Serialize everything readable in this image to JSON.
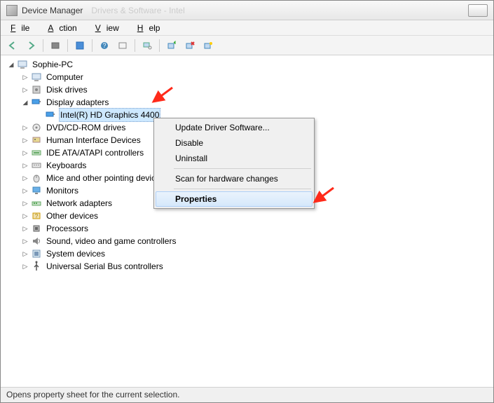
{
  "window": {
    "title": "Device Manager",
    "ghost_title": "Drivers & Software - Intel"
  },
  "menu": {
    "file": "File",
    "action": "Action",
    "view": "View",
    "help": "Help"
  },
  "toolbar": {
    "back": "back",
    "forward": "forward",
    "show_hidden": "show-hidden",
    "properties": "properties",
    "help": "help",
    "refresh": "refresh",
    "scan": "scan",
    "update": "update-driver",
    "uninstall": "uninstall",
    "browse": "browse"
  },
  "tree": {
    "root": "Sophie-PC",
    "children": [
      {
        "label": "Computer",
        "icon": "computer-icon"
      },
      {
        "label": "Disk drives",
        "icon": "disk-icon"
      },
      {
        "label": "Display adapters",
        "icon": "display-adapter-icon",
        "expanded": true,
        "children": [
          {
            "label": "Intel(R) HD Graphics 4400",
            "icon": "display-adapter-icon",
            "selected": true
          }
        ]
      },
      {
        "label": "DVD/CD-ROM drives",
        "icon": "optical-drive-icon"
      },
      {
        "label": "Human Interface Devices",
        "icon": "hid-icon"
      },
      {
        "label": "IDE ATA/ATAPI controllers",
        "icon": "ide-icon"
      },
      {
        "label": "Keyboards",
        "icon": "keyboard-icon"
      },
      {
        "label": "Mice and other pointing devices",
        "icon": "mouse-icon"
      },
      {
        "label": "Monitors",
        "icon": "monitor-icon"
      },
      {
        "label": "Network adapters",
        "icon": "network-icon"
      },
      {
        "label": "Other devices",
        "icon": "other-device-icon"
      },
      {
        "label": "Processors",
        "icon": "processor-icon"
      },
      {
        "label": "Sound, video and game controllers",
        "icon": "sound-icon"
      },
      {
        "label": "System devices",
        "icon": "system-device-icon"
      },
      {
        "label": "Universal Serial Bus controllers",
        "icon": "usb-icon"
      }
    ]
  },
  "context_menu": {
    "items": [
      {
        "label": "Update Driver Software...",
        "hover": false
      },
      {
        "label": "Disable",
        "hover": false
      },
      {
        "label": "Uninstall",
        "hover": false
      },
      {
        "sep": true
      },
      {
        "label": "Scan for hardware changes",
        "hover": false
      },
      {
        "sep": true
      },
      {
        "label": "Properties",
        "hover": true
      }
    ]
  },
  "status": {
    "text": "Opens property sheet for the current selection."
  },
  "annotations": {
    "arrow1_target": "Display adapters",
    "arrow2_target": "Properties"
  }
}
